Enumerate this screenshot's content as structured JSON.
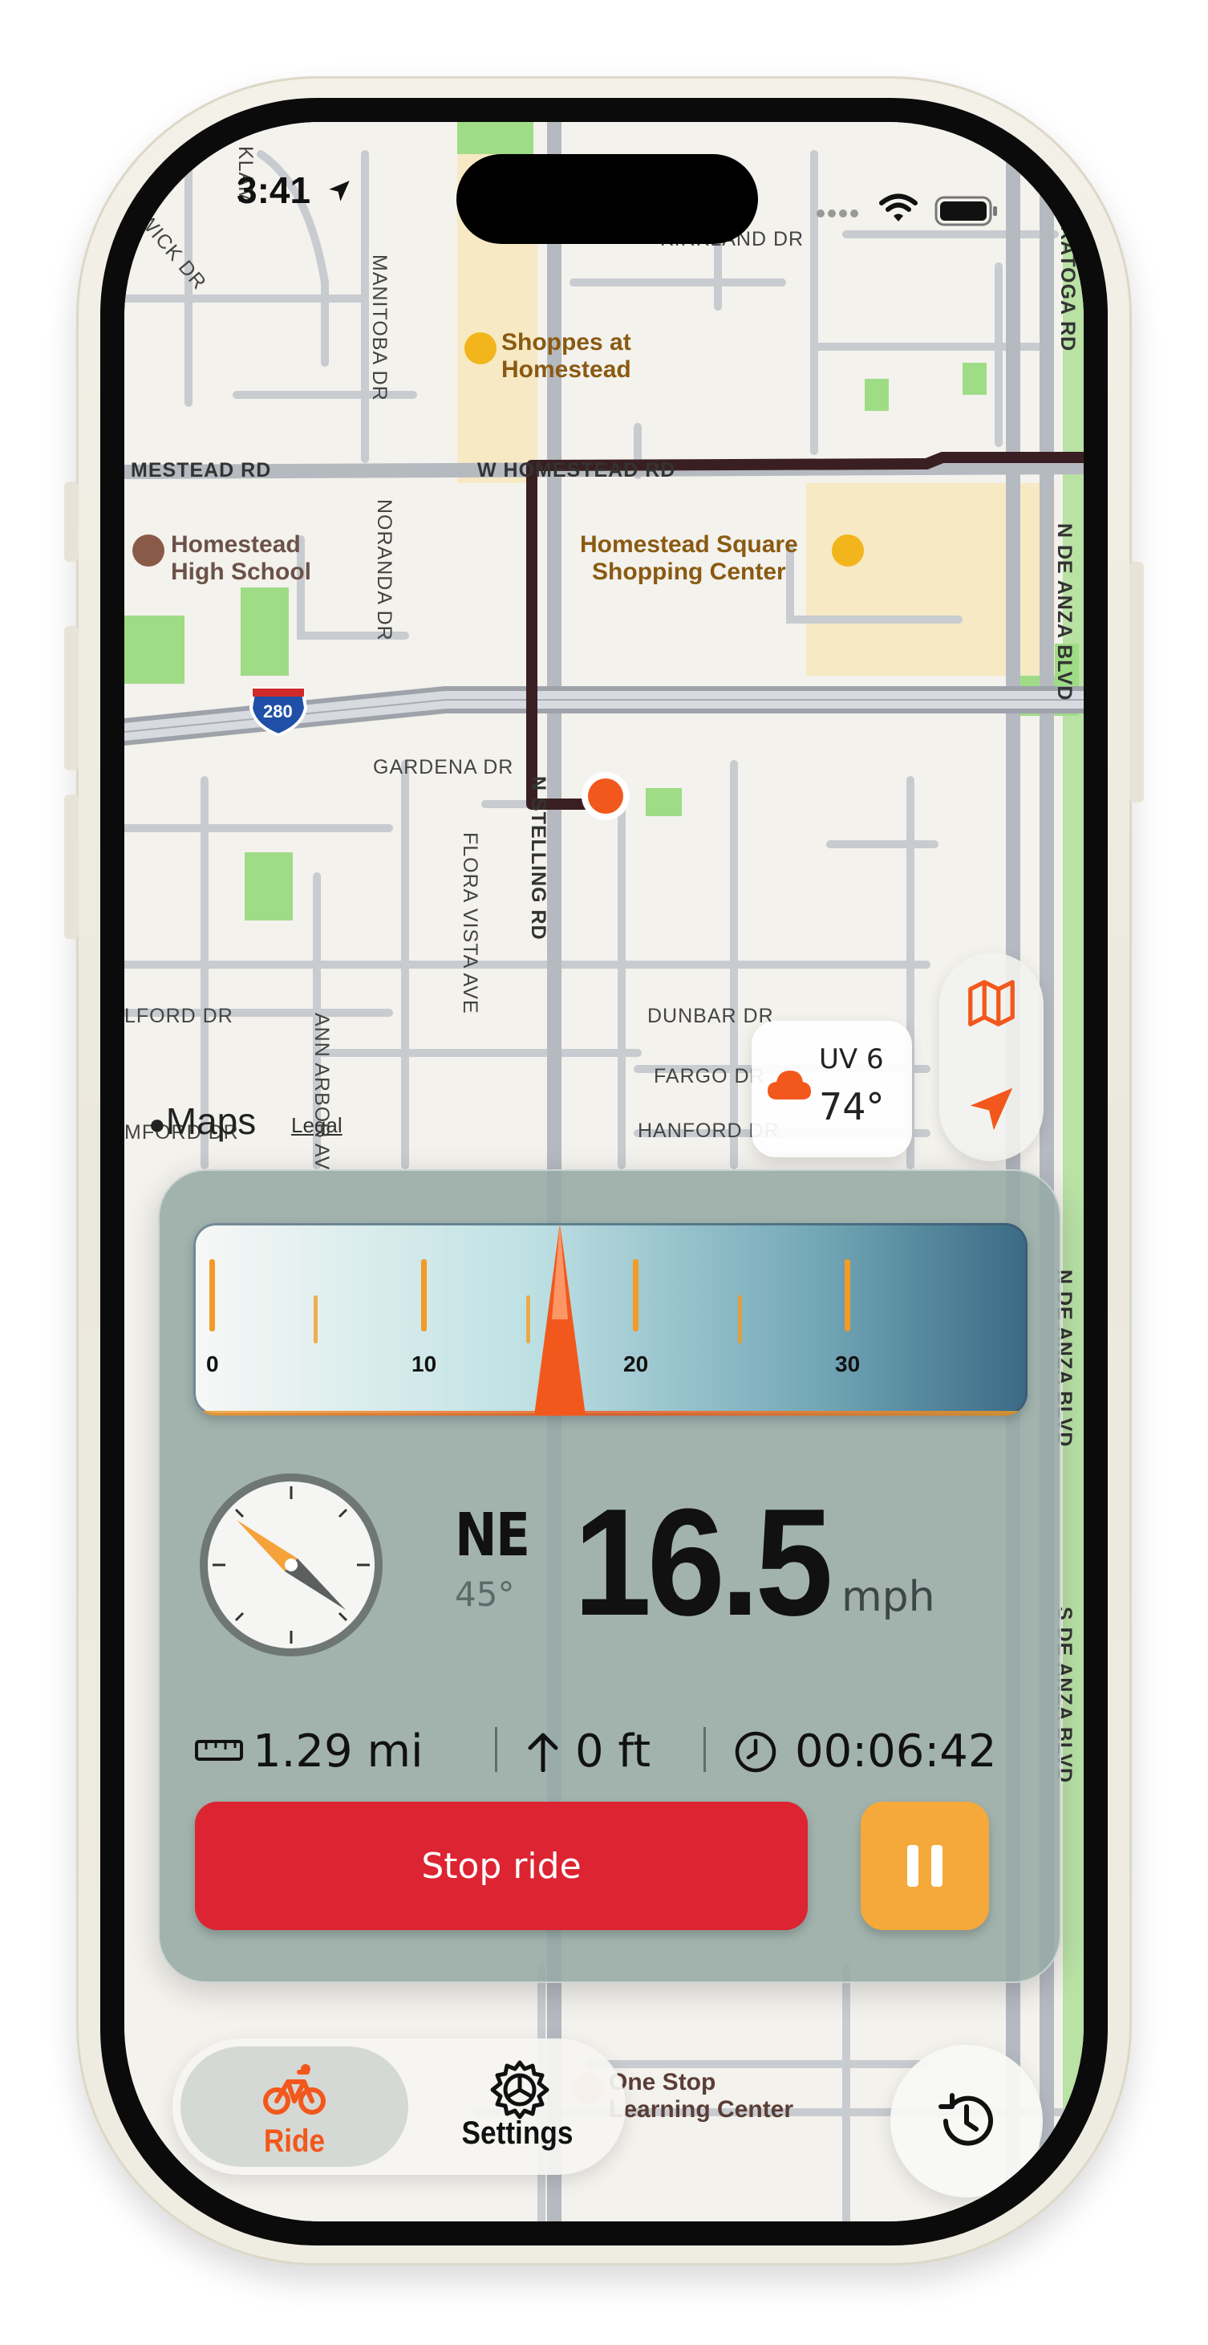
{
  "status_bar": {
    "time": "3:41"
  },
  "map": {
    "streets": {
      "kirkland": "KIRKLAND DR",
      "klamath": "KLAM",
      "newick": "NEWICK DR",
      "manitoba": "MANITOBA DR",
      "homestead_left": "MESTEAD RD",
      "w_homestead": "W HOMESTEAD RD",
      "noranda": "NORANDA DR",
      "saratoga": "ALE-SARATOGA RD",
      "n_de_anza": "N DE ANZA BLVD",
      "gardena": "GARDENA DR",
      "stelling": "N STELLING RD",
      "flora_vista": "FLORA VISTA AVE",
      "ilford": "LFORD DR",
      "ann_arbor": "ANN ARBOR AV",
      "dunbar": "DUNBAR DR",
      "fargo": "FARGO DR",
      "hanford": "HANFORD DR",
      "hanford_left": "MFORD DR",
      "n_de_anza_lower": "N DE ANZA BLVD",
      "s_de_anza": "S DE ANZA BLVD",
      "highway": "280"
    },
    "pois": {
      "shoppes": "Shoppes at\nHomestead",
      "school": "Homestead\nHigh School",
      "square": "Homestead Square\nShopping Center",
      "learning": "One Stop\nLearning Center"
    },
    "brand": "Maps",
    "legal": "Legal"
  },
  "weather": {
    "uv": "UV 6",
    "temp": "74°"
  },
  "gauge": {
    "ticks": [
      "0",
      "10",
      "20",
      "30"
    ],
    "speed_fraction": 0.55
  },
  "ride": {
    "heading_dir": "NE",
    "heading_deg": "45°",
    "speed": "16.5",
    "unit": "mph",
    "distance": "1.29 mi",
    "elevation": "0 ft",
    "elapsed": "00:06:42",
    "stop_label": "Stop ride"
  },
  "tabs": {
    "ride": "Ride",
    "settings": "Settings"
  },
  "colors": {
    "accent": "#f2581c",
    "stop": "#dc2432",
    "pause": "#f5a93b",
    "route": "#3a1f22"
  }
}
